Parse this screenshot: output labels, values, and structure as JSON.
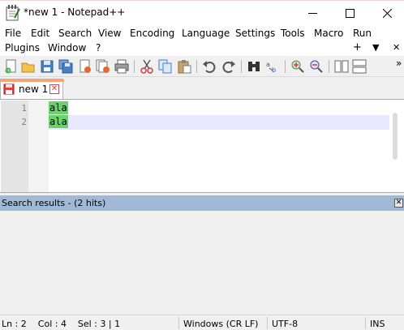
{
  "window": {
    "title": "*new 1 - Notepad++",
    "icon": "notepad-icon"
  },
  "menu": {
    "row1": [
      "File",
      "Edit",
      "Search",
      "View",
      "Encoding",
      "Language",
      "Settings",
      "Tools",
      "Macro",
      "Run"
    ],
    "row2": [
      "Plugins",
      "Window",
      "?"
    ],
    "right": [
      "+",
      "▼",
      "✕"
    ]
  },
  "toolbar": {
    "icons": [
      "new-file-icon",
      "open-file-icon",
      "save-icon",
      "save-all-icon",
      "close-icon",
      "close-all-icon",
      "print-icon",
      "cut-icon",
      "copy-icon",
      "paste-icon",
      "undo-icon",
      "redo-icon",
      "find-icon",
      "replace-icon",
      "zoom-in-icon",
      "zoom-out-icon",
      "sync-vertical-icon",
      "sync-horizontal-icon"
    ],
    "overflow": "»"
  },
  "tabs": [
    {
      "label": "new 1",
      "active": true,
      "modified": true
    }
  ],
  "editor": {
    "lines": [
      {
        "number": "1",
        "text": "ala"
      },
      {
        "number": "2",
        "text": "ala"
      }
    ],
    "current_line": 2,
    "highlight_color": "#69d269"
  },
  "search_results": {
    "title": "Search results - (2 hits)",
    "close": "✕"
  },
  "status": {
    "position": "Ln : 2    Col : 4    Sel : 3 | 1",
    "eol": "Windows (CR LF)",
    "encoding": "UTF-8",
    "mode": "INS"
  },
  "colors": {
    "search_header": "#9fb9d6",
    "tab_accent": "#f6a57a"
  }
}
